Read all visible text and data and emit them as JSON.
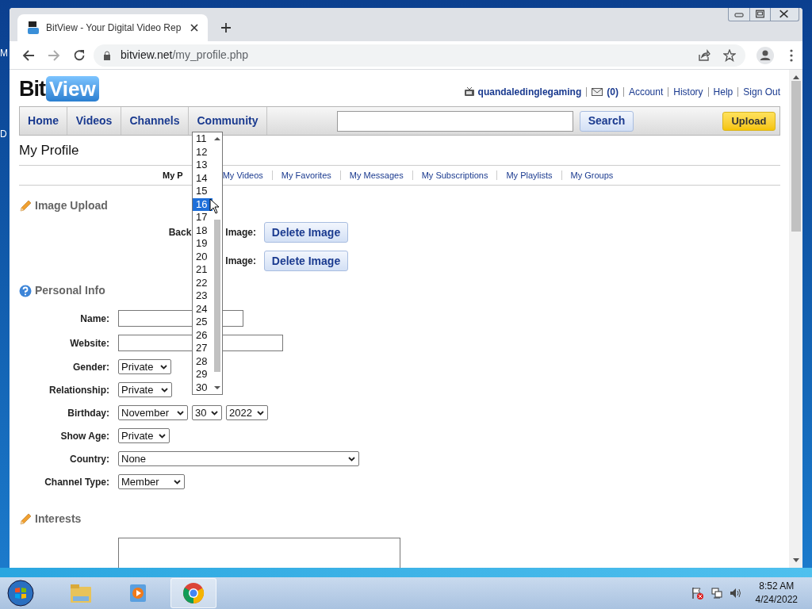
{
  "desktop": {
    "icon_label_fragments": [
      "M",
      "D"
    ]
  },
  "browser": {
    "tab": {
      "title": "BitView - Your Digital Video Rep"
    },
    "address": {
      "host": "bitview.net",
      "path": "/my_profile.php"
    }
  },
  "site": {
    "logo": {
      "bit": "Bit",
      "view": "View"
    },
    "user_bar": {
      "username": "quandaledinglegaming",
      "messages": "(0)",
      "links": [
        "Account",
        "History",
        "Help",
        "Sign Out"
      ]
    },
    "nav": [
      {
        "label": "Home"
      },
      {
        "label": "Videos"
      },
      {
        "label": "Channels"
      },
      {
        "label": "Community"
      }
    ],
    "search": {
      "button": "Search"
    },
    "upload": "Upload",
    "page_title": "My Profile",
    "subnav": [
      {
        "label": "My P",
        "selected": true
      },
      {
        "label": "My Videos",
        "selected": false
      },
      {
        "label": "My Favorites",
        "selected": false
      },
      {
        "label": "My Messages",
        "selected": false
      },
      {
        "label": "My Subscriptions",
        "selected": false
      },
      {
        "label": "My Playlists",
        "selected": false
      },
      {
        "label": "My Groups",
        "selected": false
      }
    ],
    "image_upload": {
      "heading": "Image Upload",
      "rows": [
        {
          "label_start": "Back",
          "label_end": "Image:",
          "button": "Delete Image"
        },
        {
          "label_end": "Image:",
          "button": "Delete Image"
        }
      ]
    },
    "personal_info": {
      "heading": "Personal Info",
      "rows": [
        {
          "label": "Name:",
          "kind": "text"
        },
        {
          "label": "Website:",
          "kind": "text"
        },
        {
          "label": "Gender:",
          "kind": "select",
          "values": [
            "Private"
          ]
        },
        {
          "label": "Relationship:",
          "kind": "select",
          "values": [
            "Private"
          ]
        },
        {
          "label": "Birthday:",
          "kind": "select",
          "values": [
            "November",
            "30",
            "2022"
          ]
        },
        {
          "label": "Show Age:",
          "kind": "select",
          "values": [
            "Private"
          ]
        },
        {
          "label": "Country:",
          "kind": "select",
          "values": [
            "None"
          ]
        },
        {
          "label": "Channel Type:",
          "kind": "select",
          "values": [
            "Member"
          ]
        }
      ]
    },
    "interests": {
      "heading": "Interests"
    },
    "day_dropdown": {
      "options": [
        {
          "label": "11",
          "selected": false
        },
        {
          "label": "12",
          "selected": false
        },
        {
          "label": "13",
          "selected": false
        },
        {
          "label": "14",
          "selected": false
        },
        {
          "label": "15",
          "selected": false
        },
        {
          "label": "16",
          "selected": true
        },
        {
          "label": "17",
          "selected": false
        },
        {
          "label": "18",
          "selected": false
        },
        {
          "label": "19",
          "selected": false
        },
        {
          "label": "20",
          "selected": false
        },
        {
          "label": "21",
          "selected": false
        },
        {
          "label": "22",
          "selected": false
        },
        {
          "label": "23",
          "selected": false
        },
        {
          "label": "24",
          "selected": false
        },
        {
          "label": "25",
          "selected": false
        },
        {
          "label": "26",
          "selected": false
        },
        {
          "label": "27",
          "selected": false
        },
        {
          "label": "28",
          "selected": false
        },
        {
          "label": "29",
          "selected": false
        },
        {
          "label": "30",
          "selected": false
        }
      ]
    }
  },
  "taskbar": {
    "apps": [
      {
        "kind": "folder",
        "active": false
      },
      {
        "kind": "media",
        "active": false
      },
      {
        "kind": "chrome",
        "active": true
      }
    ],
    "time": "8:52 AM",
    "date": "4/24/2022"
  }
}
